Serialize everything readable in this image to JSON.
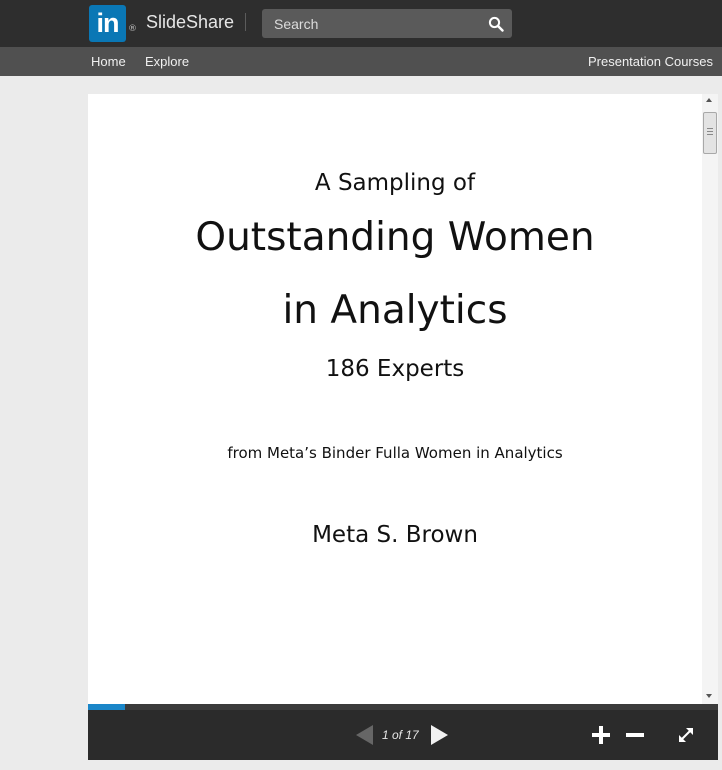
{
  "header": {
    "logo_mark": "in",
    "logo_registered": "®",
    "brand": "SlideShare",
    "search_placeholder": "Search",
    "search_icon": "search-icon"
  },
  "nav": {
    "home": "Home",
    "explore": "Explore",
    "presentation_courses": "Presentation Courses"
  },
  "slide": {
    "pre_title": "A Sampling of",
    "title_line1": "Outstanding Women",
    "title_line2": "in Analytics",
    "experts": "186 Experts",
    "source": "from Meta’s Binder Fulla Women in Analytics",
    "author": "Meta S. Brown"
  },
  "player": {
    "page_counter": "1 of 17",
    "current_page": 1,
    "total_pages": 17,
    "progress_fraction": 0.0588,
    "icons": {
      "prev": "chevron-left-icon",
      "next": "chevron-right-icon",
      "zoom_in": "plus-icon",
      "zoom_out": "minus-icon",
      "fullscreen": "expand-icon"
    }
  },
  "colors": {
    "brand_blue": "#0a77b5",
    "progress_blue": "#1a86c8",
    "header_bg": "#2e2e2e",
    "nav_bg": "#505050"
  }
}
